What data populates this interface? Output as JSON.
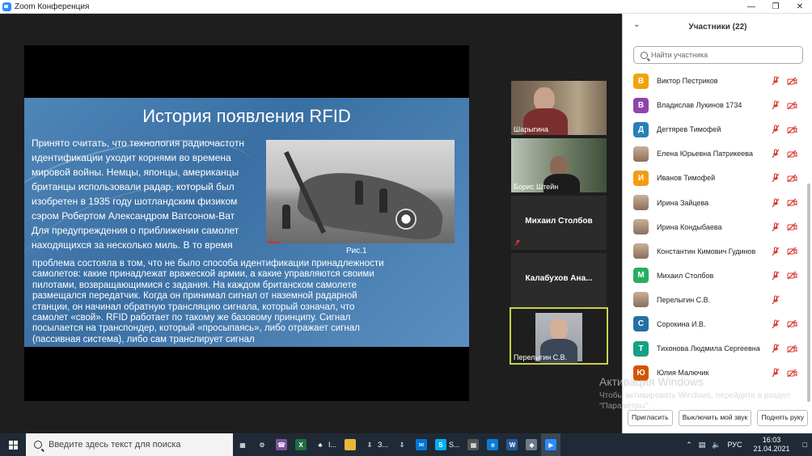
{
  "window": {
    "title": "Zoom Конференция"
  },
  "slide": {
    "title": "История появления RFID",
    "lines_top": [
      "Принято считать, что технология радиочастотн",
      "идентификации уходит корнями во времена",
      "мировой войны. Немцы, японцы, американцы",
      "британцы использовали радар, который был",
      "изобретен в 1935 году шотландским физиком",
      "сэром Робертом Александром Ватсоном-Ват",
      "Для предупреждения  о приближении самолет",
      "находящихся за несколько миль. В то время"
    ],
    "lines_bottom": [
      " проблема состояла в том, что не было способа идентификации принадлежности",
      "самолетов: какие принадлежат вражеской армии, а какие управляются своими",
      "пилотами, возвращающимися с задания. На каждом британском самолете",
      "размещался передатчик. Когда он принимал сигнал от наземной радарной",
      "станции, он начинал обратную трансляцию сигнала, который означал, что",
      "самолет «свой». RFID работает по такому же базовому принципу. Сигнал",
      "посылается на транспондер, который «просыпаясь», либо отражает сигнал",
      "(пассивная система), либо сам транслирует сигнал"
    ],
    "caption": "Рис.1"
  },
  "tiles": [
    {
      "name": "Шарыгина"
    },
    {
      "name": "Борис Штейн"
    },
    {
      "name": "Михаил Столбов"
    },
    {
      "name": "Калабухов  Ана..."
    },
    {
      "name": "Перелыгин С.В."
    }
  ],
  "panel": {
    "title": "Участники (22)",
    "search_placeholder": "Найти участника",
    "participants": [
      {
        "initial": "В",
        "color": "#f0a30a",
        "name": "Виктор Пестриков",
        "cam": true
      },
      {
        "initial": "В",
        "color": "#8e44ad",
        "name": "Владислав Лукинов 1734",
        "cam": true
      },
      {
        "initial": "Д",
        "color": "#2980b9",
        "name": "Дегтярев Тимофей",
        "cam": true
      },
      {
        "initial": "",
        "color": "",
        "name": "Елена Юрьевна Патрикеева",
        "cam": true
      },
      {
        "initial": "И",
        "color": "#f39c12",
        "name": "Иванов Тимофей",
        "cam": true
      },
      {
        "initial": "",
        "color": "",
        "name": "Ирина Зайцева",
        "cam": true
      },
      {
        "initial": "",
        "color": "",
        "name": "Ирина Кондыбаева",
        "cam": true
      },
      {
        "initial": "",
        "color": "",
        "name": "Константин Кимович Гудинов",
        "cam": true
      },
      {
        "initial": "М",
        "color": "#27ae60",
        "name": "Михаил Столбов",
        "cam": true
      },
      {
        "initial": "",
        "color": "",
        "name": "Перелыгин С.В.",
        "cam": false
      },
      {
        "initial": "С",
        "color": "#2471a3",
        "name": "Сорокина И.В.",
        "cam": true
      },
      {
        "initial": "Т",
        "color": "#16a085",
        "name": "Тихонова Людмила Сергеевна",
        "cam": true
      },
      {
        "initial": "Ю",
        "color": "#d35400",
        "name": "Юлия Малючик",
        "cam": true
      }
    ],
    "activation_title": "Активация Windows",
    "activation_text": "Чтобы активировать Windows, перейдите в раздел \"Параметры\".",
    "buttons": {
      "invite": "Пригласить",
      "mute": "Выключить мой звук",
      "raise": "Поднять руку"
    }
  },
  "taskbar": {
    "search_placeholder": "Введите здесь текст для поиска",
    "apps": [
      {
        "icon": "task-view-icon",
        "label": ""
      },
      {
        "icon": "settings-icon",
        "label": ""
      },
      {
        "icon": "viber-icon",
        "label": ""
      },
      {
        "icon": "excel-icon",
        "label": ""
      },
      {
        "icon": "clover-icon",
        "label": "I..."
      },
      {
        "icon": "folder-icon",
        "label": ""
      },
      {
        "icon": "download-icon",
        "label": "З..."
      },
      {
        "icon": "download-icon",
        "label": ""
      },
      {
        "icon": "mail-icon",
        "label": ""
      },
      {
        "icon": "skype-icon",
        "label": "S..."
      },
      {
        "icon": "calculator-icon",
        "label": ""
      },
      {
        "icon": "edge-icon",
        "label": ""
      },
      {
        "icon": "word-icon",
        "label": ""
      },
      {
        "icon": "app-icon",
        "label": ""
      },
      {
        "icon": "zoom-icon",
        "label": ""
      }
    ],
    "lang": "РУС",
    "time": "16:03",
    "date": "21.04.2021"
  }
}
